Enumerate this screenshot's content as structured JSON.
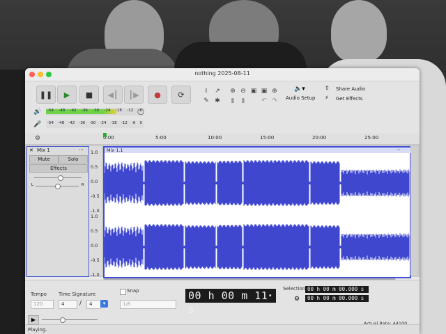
{
  "window": {
    "title": "nothing 2025-08-11"
  },
  "toolbar": {
    "audio_setup_label": "Audio Setup",
    "share_audio_label": "Share Audio",
    "get_effects_label": "Get Effects",
    "record_meter_ticks": [
      "-54",
      "-48",
      "-42",
      "-36",
      "-30",
      "-24",
      "-18",
      "-12",
      "-6"
    ],
    "playback_meter_ticks": [
      "-54",
      "-48",
      "-42",
      "-36",
      "-30",
      "-24",
      "-18",
      "-12",
      "-6",
      "0"
    ],
    "record_meter_level": 0.72
  },
  "timeline": {
    "ticks": [
      "0:00",
      "5:00",
      "10:00",
      "15:00",
      "20:00",
      "25:00"
    ]
  },
  "track": {
    "name": "Mix 1",
    "mute_label": "Mute",
    "solo_label": "Solo",
    "effects_label": "Effects",
    "pan_left": "L",
    "pan_right": "R",
    "clip_name": "Mix 1.1",
    "ruler_labels": [
      "1.0",
      "0.5",
      "0.0",
      "-0.5",
      "-1.0",
      "1.0",
      "0.5",
      "0.0",
      "-0.5",
      "-1.0"
    ]
  },
  "bottom": {
    "tempo_label": "Tempo",
    "tempo_value": "120",
    "time_signature_label": "Time Signature",
    "ts_numerator": "4",
    "ts_slash": "/",
    "ts_denominator": "4",
    "snap_label": "Snap",
    "snap_value": "1/8",
    "time_display": "00 h 00 m 11 s",
    "selection_label": "Selection",
    "selection_start": "00 h 00 m 00.000 s",
    "selection_end": "00 h 00 m 00.000 s",
    "actual_rate_label": "Actual Rate: 44100",
    "status_text": "Playing."
  },
  "colors": {
    "waveform": "#3f47cf",
    "accent": "#4a5bd0",
    "meter_green": "#6fd34a"
  }
}
